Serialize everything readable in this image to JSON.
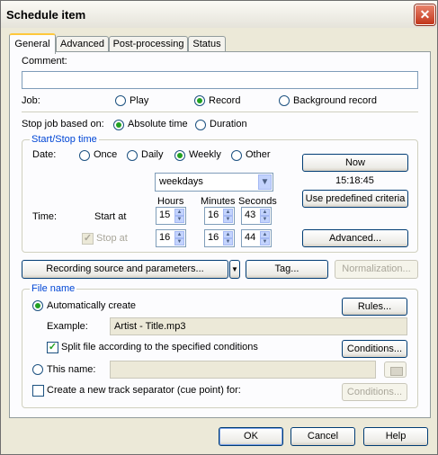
{
  "window": {
    "title": "Schedule item"
  },
  "tabs": [
    {
      "label": "General"
    },
    {
      "label": "Advanced"
    },
    {
      "label": "Post-processing"
    },
    {
      "label": "Status"
    }
  ],
  "comment": {
    "label": "Comment:",
    "value": ""
  },
  "job": {
    "label": "Job:",
    "options": [
      "Play",
      "Record",
      "Background record"
    ],
    "selected": "Record"
  },
  "stop_job": {
    "label": "Stop job based on:",
    "options": [
      "Absolute time",
      "Duration"
    ],
    "selected": "Absolute time"
  },
  "start_stop": {
    "group_label": "Start/Stop time",
    "date_label": "Date:",
    "date_options": [
      "Once",
      "Daily",
      "Weekly",
      "Other"
    ],
    "date_selected": "Weekly",
    "days_combo": "weekdays",
    "now_button": "Now",
    "clock": "15:18:45",
    "predefined_button": "Use predefined criteria",
    "col_hours": "Hours",
    "col_minutes": "Minutes",
    "col_seconds": "Seconds",
    "time_label": "Time:",
    "start_label": "Start at",
    "start": {
      "h": "15",
      "m": "16",
      "s": "43"
    },
    "stop_label": "Stop at",
    "stop": {
      "h": "16",
      "m": "16",
      "s": "44"
    },
    "advanced_button": "Advanced..."
  },
  "actions": {
    "recording_source": "Recording source and parameters...",
    "tag": "Tag...",
    "normalization": "Normalization..."
  },
  "file_name": {
    "group_label": "File name",
    "auto_label": "Automatically create",
    "rules_button": "Rules...",
    "example_label": "Example:",
    "example_value": "Artist - Title.mp3",
    "split_label": "Split file according to the specified conditions",
    "conditions_button": "Conditions...",
    "this_name_label": "This name:",
    "this_name_value": "",
    "track_sep_label": "Create a new track separator (cue point) for:",
    "conditions2_button": "Conditions..."
  },
  "footer": {
    "ok": "OK",
    "cancel": "Cancel",
    "help": "Help"
  },
  "colors": {
    "accent": "#0046d5",
    "selected_radio": "#21a121",
    "tab_highlight": "#ffc83c"
  }
}
